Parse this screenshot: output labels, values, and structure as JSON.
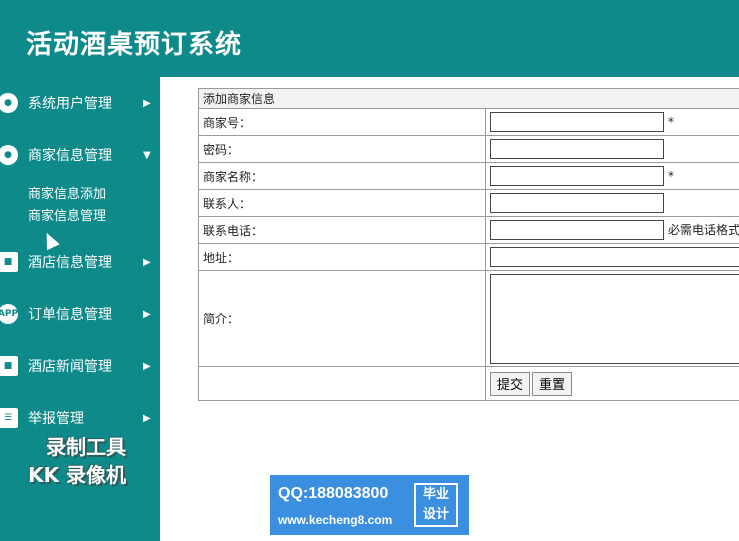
{
  "app": {
    "title": "活动酒桌预订系统"
  },
  "sidebar": {
    "items": [
      {
        "label": "系统用户管理",
        "icon": "user-icon",
        "arrow": "▶"
      },
      {
        "label": "商家信息管理",
        "icon": "shop-user-icon",
        "arrow": "▼",
        "subitems": [
          "商家信息添加",
          "商家信息管理"
        ]
      },
      {
        "label": "酒店信息管理",
        "icon": "hotel-icon",
        "arrow": "▶"
      },
      {
        "label": "订单信息管理",
        "icon": "app-icon",
        "icon_text": "APP",
        "arrow": "▶"
      },
      {
        "label": "酒店新闻管理",
        "icon": "news-icon",
        "arrow": "▶"
      },
      {
        "label": "举报管理",
        "icon": "report-icon",
        "arrow": "▶"
      }
    ]
  },
  "watermark": {
    "line1": "录制工具",
    "line2": "KK 录像机"
  },
  "form": {
    "caption": "添加商家信息",
    "fields": [
      {
        "label": "商家号：",
        "value": "",
        "suffix": "*"
      },
      {
        "label": "密码：",
        "value": "",
        "suffix": ""
      },
      {
        "label": "商家名称：",
        "value": "",
        "suffix": "*"
      },
      {
        "label": "联系人：",
        "value": "",
        "suffix": ""
      },
      {
        "label": "联系电话：",
        "value": "",
        "suffix": "必需电话格式"
      },
      {
        "label": "地址：",
        "value": "",
        "suffix": ""
      },
      {
        "label": "简介：",
        "value": ""
      }
    ],
    "submit_label": "提交",
    "reset_label": "重置"
  },
  "banner": {
    "qq": "QQ:188083800",
    "site": "www.kecheng8.com",
    "badge": "毕业\n设计"
  },
  "colors": {
    "teal": "#0f8a8a",
    "banner_blue": "#3a8fe0"
  }
}
